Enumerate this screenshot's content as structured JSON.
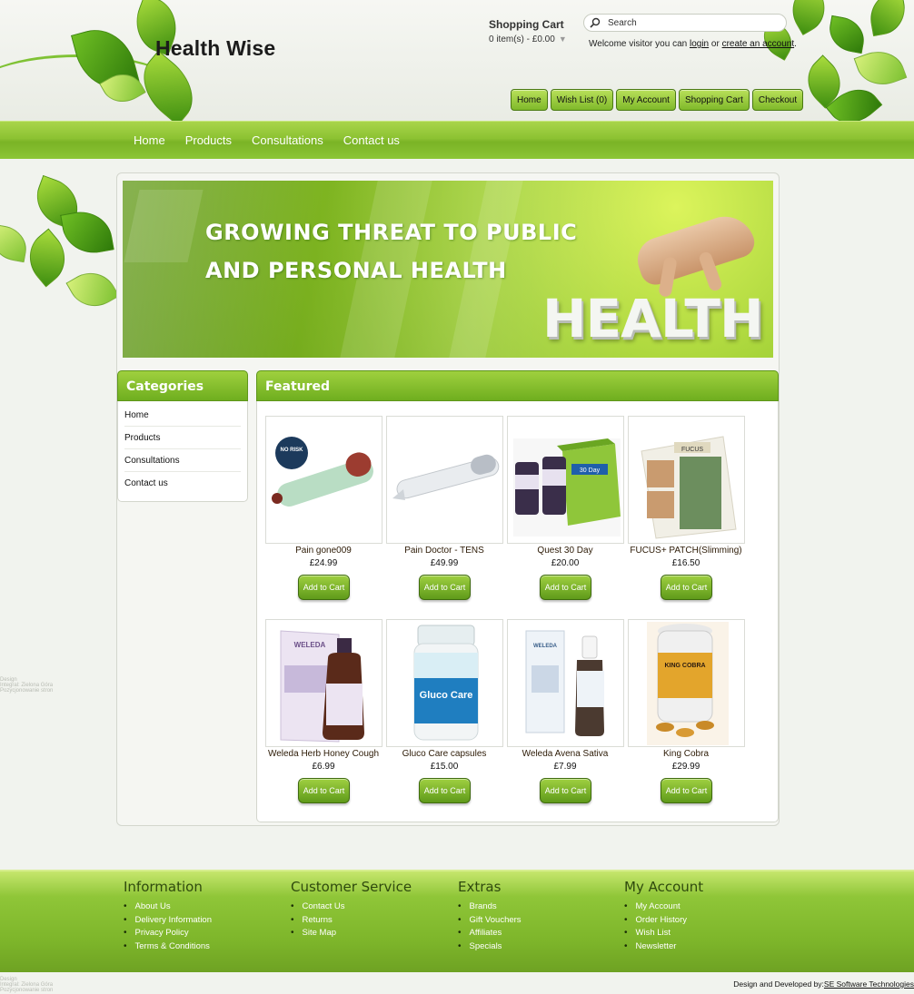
{
  "header": {
    "logo_text": "Health Wise",
    "cart_title": "Shopping Cart",
    "cart_summary": "0 item(s) - £0.00",
    "search_placeholder": "Search",
    "welcome_prefix": "Welcome visitor you can",
    "login_label": "login",
    "or_text": "or",
    "create_account_label": "create an account",
    "welcome_suffix": ".",
    "top_links": [
      "Home",
      "Wish List (0)",
      "My Account",
      "Shopping Cart",
      "Checkout"
    ]
  },
  "nav": {
    "items": [
      "Home",
      "Products",
      "Consultations",
      "Contact us"
    ]
  },
  "banner": {
    "line1": "GROWING THREAT TO PUBLIC",
    "line2": "AND PERSONAL HEALTH",
    "big_word": "HEALTH"
  },
  "categories": {
    "title": "Categories",
    "items": [
      "Home",
      "Products",
      "Consultations",
      "Contact us"
    ]
  },
  "featured": {
    "title": "Featured",
    "add_label": "Add to Cart",
    "products": [
      {
        "name": "Pain gone009",
        "price": "£24.99",
        "image_text": "NO RISK"
      },
      {
        "name": "Pain Doctor - TENS",
        "price": "£49.99",
        "image_text": ""
      },
      {
        "name": "Quest 30 Day",
        "price": "£20.00",
        "image_text": "30 Day"
      },
      {
        "name": "FUCUS+ PATCH(Slimming)",
        "price": "£16.50",
        "image_text": "FUCUS"
      },
      {
        "name": "Weleda Herb Honey Cough",
        "price": "£6.99",
        "image_text": "WELEDA"
      },
      {
        "name": "Gluco Care capsules",
        "price": "£15.00",
        "image_text": "Gluco Care"
      },
      {
        "name": "Weleda Avena Sativa",
        "price": "£7.99",
        "image_text": "WELEDA"
      },
      {
        "name": "King Cobra",
        "price": "£29.99",
        "image_text": "KING COBRA"
      }
    ]
  },
  "footer": {
    "columns": [
      {
        "title": "Information",
        "links": [
          "About Us",
          "Delivery Information",
          "Privacy Policy",
          "Terms & Conditions"
        ]
      },
      {
        "title": "Customer Service",
        "links": [
          "Contact Us",
          "Returns",
          "Site Map"
        ]
      },
      {
        "title": "Extras",
        "links": [
          "Brands",
          "Gift Vouchers",
          "Affiliates",
          "Specials"
        ]
      },
      {
        "title": "My Account",
        "links": [
          "My Account",
          "Order History",
          "Wish List",
          "Newsletter"
        ]
      }
    ],
    "credit_prefix": "Design and Developed by:",
    "credit_link": "SE Software Technologies"
  },
  "design_note": [
    "Design",
    "Integral: Zielona Góra",
    "Pozycjonowanie stron"
  ],
  "colors": {
    "accent_green": "#8cc232",
    "dark_green": "#5e961a",
    "footer_heading": "#2f4a0d"
  }
}
